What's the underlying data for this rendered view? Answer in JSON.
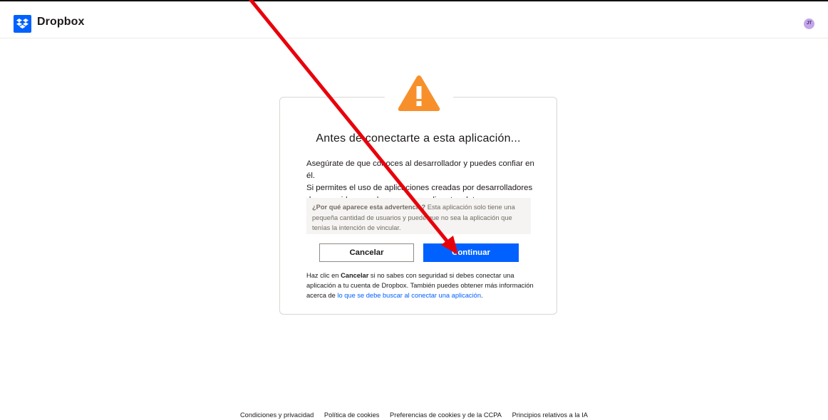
{
  "header": {
    "brand": "Dropbox",
    "logo_icon": "dropbox-logo-icon",
    "avatar_initials": "JT"
  },
  "dialog": {
    "icon": "warning-triangle-icon",
    "title": "Antes de conectarte a esta aplicación...",
    "body_line1": "Asegúrate de que conoces al desarrollador y puedes confiar en él.",
    "body_line2": "Si permites el uso de aplicaciones creadas por desarrolladores",
    "body_line3": "desconocidos, puedes poner en peligro tus datos.",
    "notice_bold": "¿Por qué aparece esta advertencia?",
    "notice_text": " Esta aplicación solo tiene una pequeña cantidad de usuarios y puede que no sea la aplicación que tenías la intención de vincular.",
    "cancel_label": "Cancelar",
    "continue_label": "Continuar",
    "help_prefix": "Haz clic en ",
    "help_bold": "Cancelar",
    "help_middle": " si no sabes con seguridad si debes conectar una aplicación a tu cuenta de Dropbox. También puedes obtener más información acerca de ",
    "help_link": "lo que se debe buscar al conectar una aplicación",
    "help_suffix": "."
  },
  "footer": {
    "links": [
      "Condiciones y privacidad",
      "Política de cookies",
      "Preferencias de cookies y de la CCPA",
      "Principios relativos a la IA"
    ]
  },
  "colors": {
    "accent": "#0061fe",
    "warning": "#f7902b",
    "annotation_arrow": "#e8000b"
  }
}
